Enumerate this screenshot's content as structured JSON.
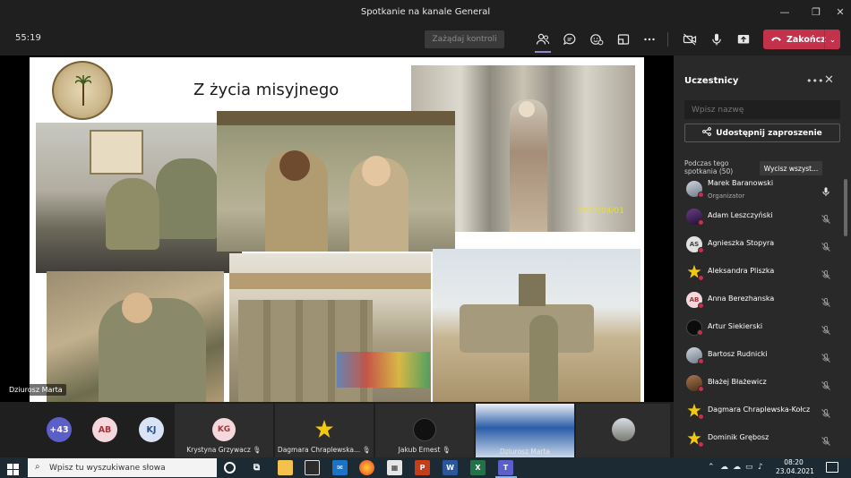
{
  "window": {
    "title": "Spotkanie na kanale General"
  },
  "meeting": {
    "timer": "55:19",
    "request_control_label": "Zażądaj kontroli",
    "end_label": "Zakończ"
  },
  "slide": {
    "title": "Z życia misyjnego",
    "photo_date": "2007/04/01",
    "speaker": "Dziurosz Marta"
  },
  "panel": {
    "heading": "Uczestnicy",
    "search_placeholder": "Wpisz nazwę",
    "share_label": "Udostępnij zaproszenie",
    "section_label": "Podczas tego spotkania (50)",
    "mute_all_label": "Wycisz wszyst...",
    "participants": [
      {
        "name": "Marek Baranowski",
        "role": "Organizator",
        "initials": "",
        "avatar": "photo"
      },
      {
        "name": "Adam Leszczyński",
        "initials": "",
        "avatar": "photo-dark"
      },
      {
        "name": "Agnieszka Stopyra",
        "initials": "AS",
        "avatar": "initials-grey"
      },
      {
        "name": "Aleksandra Pliszka",
        "initials": "",
        "avatar": "star"
      },
      {
        "name": "Anna Berezhanska",
        "initials": "AB",
        "avatar": "initials-pink"
      },
      {
        "name": "Artur Siekierski",
        "initials": "",
        "avatar": "photo-black"
      },
      {
        "name": "Bartosz Rudnicki",
        "initials": "",
        "avatar": "photo"
      },
      {
        "name": "Błażej Błażewicz",
        "initials": "",
        "avatar": "photo-brown"
      },
      {
        "name": "Dagmara Chraplewska-Kołcz",
        "initials": "",
        "avatar": "star"
      },
      {
        "name": "Dominik Grębosz",
        "initials": "",
        "avatar": "star"
      }
    ]
  },
  "strip": {
    "more_count": "+43",
    "bubbles": [
      "AB",
      "KJ"
    ],
    "tiles": [
      {
        "name": "Krystyna Grzywacz",
        "initials": "KG"
      },
      {
        "name": "Dagmara Chraplewska...",
        "initials": ""
      },
      {
        "name": "Jakub Ernest",
        "initials": ""
      },
      {
        "name": "Dziurosz Marta",
        "initials": ""
      },
      {
        "name": "",
        "initials": ""
      }
    ]
  },
  "taskbar": {
    "search_placeholder": "Wpisz tu wyszukiwane słowa",
    "time": "08:20",
    "date": "23.04.2021"
  }
}
